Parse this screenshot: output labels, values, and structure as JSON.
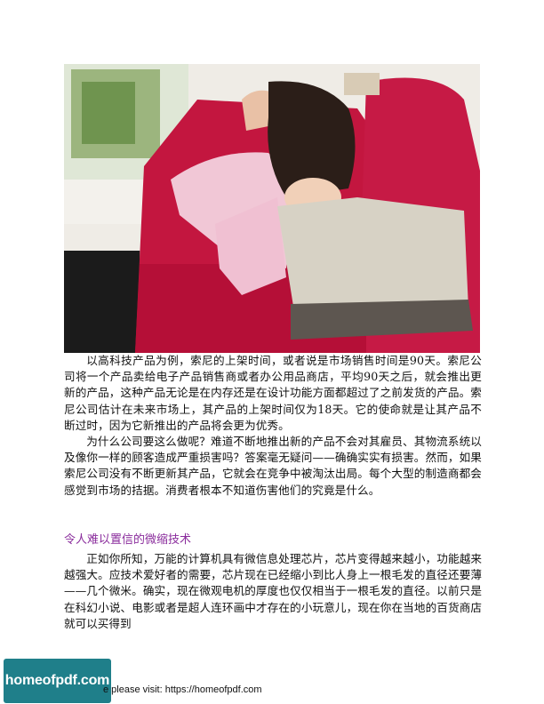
{
  "photo": {
    "description_icon": "girl-on-sofa-with-laptop-photo"
  },
  "paragraphs": [
    "以高科技产品为例，索尼的上架时间，或者说是市场销售时间是90天。索尼公司将一个产品卖给电子产品销售商或者办公用品商店，平均90天之后，就会推出更新的产品，这种产品无论是在内存还是在设计功能方面都超过了之前发货的产品。索尼公司估计在未来市场上，其产品的上架时间仅为18天。它的使命就是让其产品不断过时，因为它新推出的产品将会更为优秀。",
    "为什么公司要这么做呢？难道不断地推出新的产品不会对其雇员、其物流系统以及像你一样的顾客造成严重损害吗？答案毫无疑问——确确实实有损害。然而，如果索尼公司没有不断更新其产品，它就会在竞争中被淘汰出局。每个大型的制造商都会感觉到市场的拮据。消费者根本不知道伤害他们的究竟是什么。"
  ],
  "section": {
    "heading": "令人难以置信的微缩技术",
    "paragraph": "正如你所知，万能的计算机具有微信息处理芯片，芯片变得越来越小，功能越来越强大。应技术爱好者的需要，芯片现在已经缩小到比人身上一根毛发的直径还要薄——几个微米。确实，现在微观电机的厚度也仅仅相当于一根毛发的直径。以前只是在科幻小说、电影或者是超人连环画中才存在的小玩意儿，现在你在当地的百货商店就可以买得到"
  },
  "footer": {
    "text": "e please visit: https://homeofpdf.com"
  },
  "logo": {
    "text": "homeofpdf.com",
    "color": "#1f7f8a"
  }
}
